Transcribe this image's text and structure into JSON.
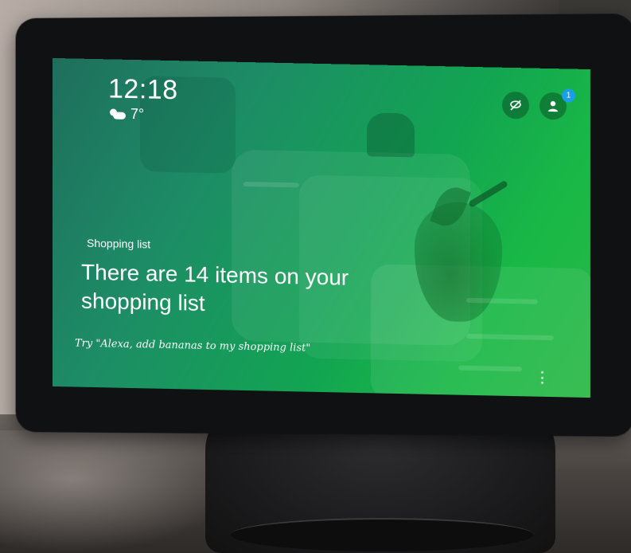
{
  "status": {
    "time": "12:18",
    "temperature": "7°",
    "weather_icon": "partly-cloudy-icon"
  },
  "top_bar": {
    "dnd_icon": "do-not-disturb-icon",
    "profile_icon": "person-icon",
    "notification_count": "1"
  },
  "card": {
    "category_label": "Shopping list",
    "headline": "There are 14 items on your shopping list",
    "hint": "Try \"Alexa, add bananas to my shopping list\""
  },
  "colors": {
    "screen_start": "#1f6e5c",
    "screen_end": "#2ab845",
    "badge": "#1a9ee8"
  }
}
